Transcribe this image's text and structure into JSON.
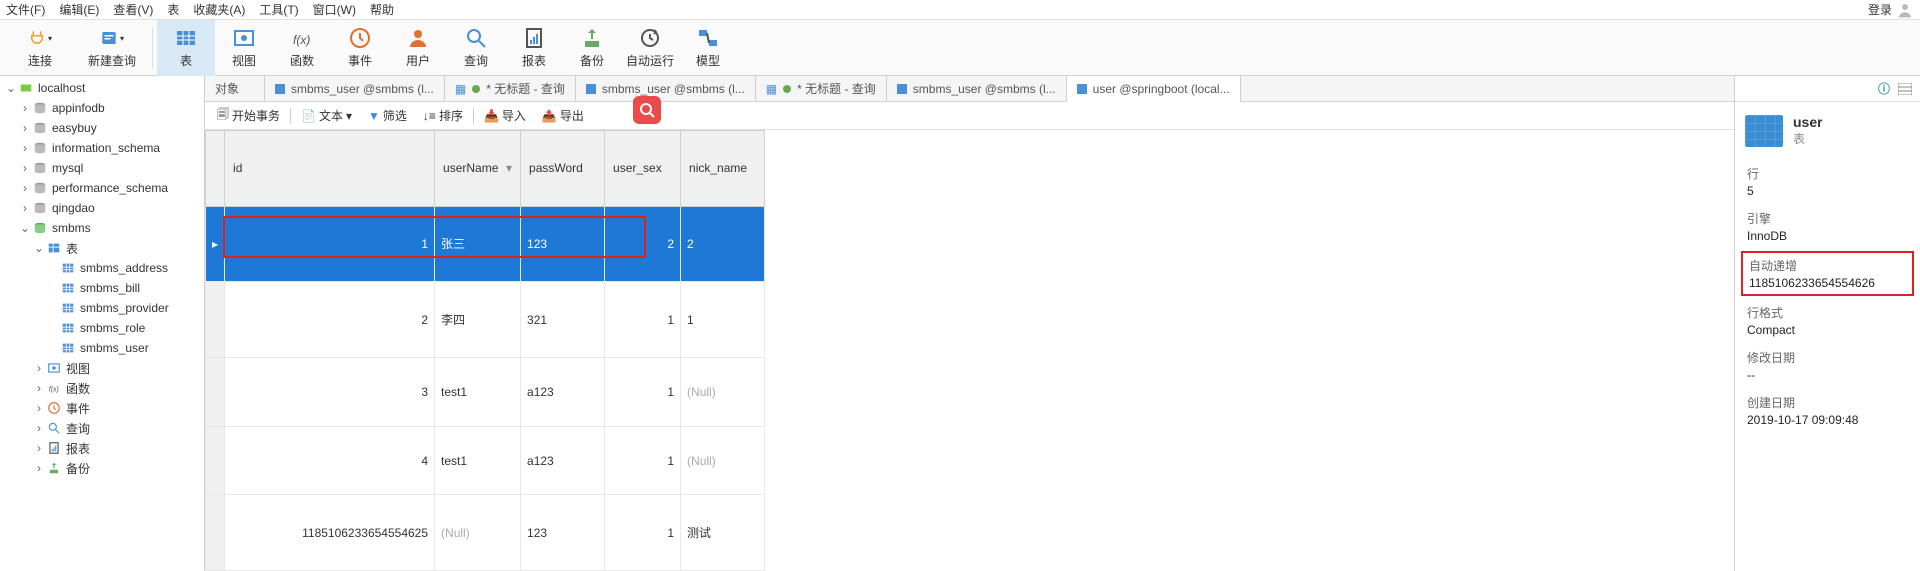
{
  "menu": [
    "文件(F)",
    "编辑(E)",
    "查看(V)",
    "表",
    "收藏夹(A)",
    "工具(T)",
    "窗口(W)",
    "帮助"
  ],
  "login": "登录",
  "toolbar": [
    {
      "label": "连接",
      "icon": "plug",
      "drop": true
    },
    {
      "label": "新建查询",
      "icon": "query",
      "drop": true
    },
    {
      "sep": true
    },
    {
      "label": "表",
      "icon": "table",
      "active": true
    },
    {
      "label": "视图",
      "icon": "view"
    },
    {
      "label": "函数",
      "icon": "fx"
    },
    {
      "label": "事件",
      "icon": "clock"
    },
    {
      "label": "用户",
      "icon": "user"
    },
    {
      "label": "查询",
      "icon": "search"
    },
    {
      "label": "报表",
      "icon": "report"
    },
    {
      "label": "备份",
      "icon": "backup"
    },
    {
      "label": "自动运行",
      "icon": "auto"
    },
    {
      "label": "模型",
      "icon": "model"
    }
  ],
  "tree": [
    {
      "l": 0,
      "tw": "v",
      "ico": "conn",
      "txt": "localhost"
    },
    {
      "l": 1,
      "tw": ">",
      "ico": "db",
      "txt": "appinfodb"
    },
    {
      "l": 1,
      "tw": ">",
      "ico": "db",
      "txt": "easybuy"
    },
    {
      "l": 1,
      "tw": ">",
      "ico": "db",
      "txt": "information_schema"
    },
    {
      "l": 1,
      "tw": ">",
      "ico": "db",
      "txt": "mysql"
    },
    {
      "l": 1,
      "tw": ">",
      "ico": "db",
      "txt": "performance_schema"
    },
    {
      "l": 1,
      "tw": ">",
      "ico": "db",
      "txt": "qingdao"
    },
    {
      "l": 1,
      "tw": "v",
      "ico": "dbopen",
      "txt": "smbms"
    },
    {
      "l": 2,
      "tw": "v",
      "ico": "tblgrp",
      "txt": "表"
    },
    {
      "l": 3,
      "tw": "",
      "ico": "tbl",
      "txt": "smbms_address"
    },
    {
      "l": 3,
      "tw": "",
      "ico": "tbl",
      "txt": "smbms_bill"
    },
    {
      "l": 3,
      "tw": "",
      "ico": "tbl",
      "txt": "smbms_provider"
    },
    {
      "l": 3,
      "tw": "",
      "ico": "tbl",
      "txt": "smbms_role"
    },
    {
      "l": 3,
      "tw": "",
      "ico": "tbl",
      "txt": "smbms_user"
    },
    {
      "l": 2,
      "tw": ">",
      "ico": "view",
      "txt": "视图"
    },
    {
      "l": 2,
      "tw": ">",
      "ico": "fx",
      "txt": "函数"
    },
    {
      "l": 2,
      "tw": ">",
      "ico": "clock",
      "txt": "事件"
    },
    {
      "l": 2,
      "tw": ">",
      "ico": "search",
      "txt": "查询"
    },
    {
      "l": 2,
      "tw": ">",
      "ico": "report",
      "txt": "报表"
    },
    {
      "l": 2,
      "tw": ">",
      "ico": "backup",
      "txt": "备份"
    }
  ],
  "tabs": [
    {
      "label": "对象",
      "ico": null
    },
    {
      "label": "smbms_user @smbms (l...",
      "ico": "tbl"
    },
    {
      "label": "* 无标题 - 查询",
      "ico": "qry"
    },
    {
      "label": "smbms_user @smbms (l...",
      "ico": "tbl"
    },
    {
      "label": "* 无标题 - 查询",
      "ico": "qry"
    },
    {
      "label": "smbms_user @smbms (l...",
      "ico": "tbl"
    },
    {
      "label": "user @springboot (local...",
      "ico": "tbl",
      "active": true
    }
  ],
  "subtb": {
    "begin": "开始事务",
    "text": "文本",
    "filter": "筛选",
    "sort": "排序",
    "import": "导入",
    "export": "导出"
  },
  "cols": [
    "id",
    "userName",
    "passWord",
    "user_sex",
    "nick_name"
  ],
  "widths": [
    210,
    86,
    84,
    76,
    84
  ],
  "rows": [
    {
      "sel": true,
      "d": [
        "1",
        "张三",
        "123",
        "2",
        "2"
      ]
    },
    {
      "d": [
        "2",
        "李四",
        "321",
        "1",
        "1"
      ]
    },
    {
      "d": [
        "3",
        "test1",
        "a123",
        "1",
        "(Null)"
      ],
      "nullcols": [
        4
      ]
    },
    {
      "d": [
        "4",
        "test1",
        "a123",
        "1",
        "(Null)"
      ],
      "nullcols": [
        4
      ]
    },
    {
      "d": [
        "1185106233654554625",
        "(Null)",
        "123",
        "1",
        "测试"
      ],
      "nullcols": [
        1
      ]
    }
  ],
  "right": {
    "title": "user",
    "sub": "表",
    "rows_l": "行",
    "rows_v": "5",
    "engine_l": "引擎",
    "engine_v": "InnoDB",
    "ai_l": "自动递增",
    "ai_v": "1185106233654554626",
    "fmt_l": "行格式",
    "fmt_v": "Compact",
    "mod_l": "修改日期",
    "mod_v": "--",
    "crt_l": "创建日期",
    "crt_v": "2019-10-17 09:09:48"
  }
}
